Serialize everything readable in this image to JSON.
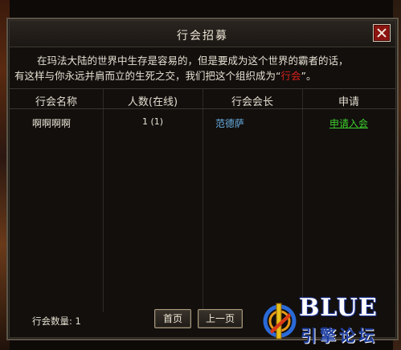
{
  "dialog": {
    "title": "行会招募",
    "intro_line1": "在玛法大陆的世界中生存是容易的，但是要成为这个世界的霸者的话，",
    "intro_line2_a": "有这样与你永远并肩而立的生死之交，我们把这个组织成为“",
    "intro_highlight": "行会",
    "intro_line2_b": "”。"
  },
  "table": {
    "headers": [
      "行会名称",
      "人数(在线)",
      "行会会长",
      "申请"
    ],
    "rows": [
      {
        "name": "啊啊啊啊",
        "count": "1 (1)",
        "leader": "范德萨",
        "apply": "申请入会"
      }
    ]
  },
  "footer": {
    "guild_count": "行会数量: 1",
    "first_page": "首页",
    "prev_page": "上一页"
  },
  "logo": {
    "main": "BLUE",
    "sub": "引擎论坛"
  },
  "colors": {
    "highlight": "#d8201a",
    "leader": "#6ab0e4",
    "apply_link": "#3ccd2c",
    "close_button": "#8c1410"
  }
}
